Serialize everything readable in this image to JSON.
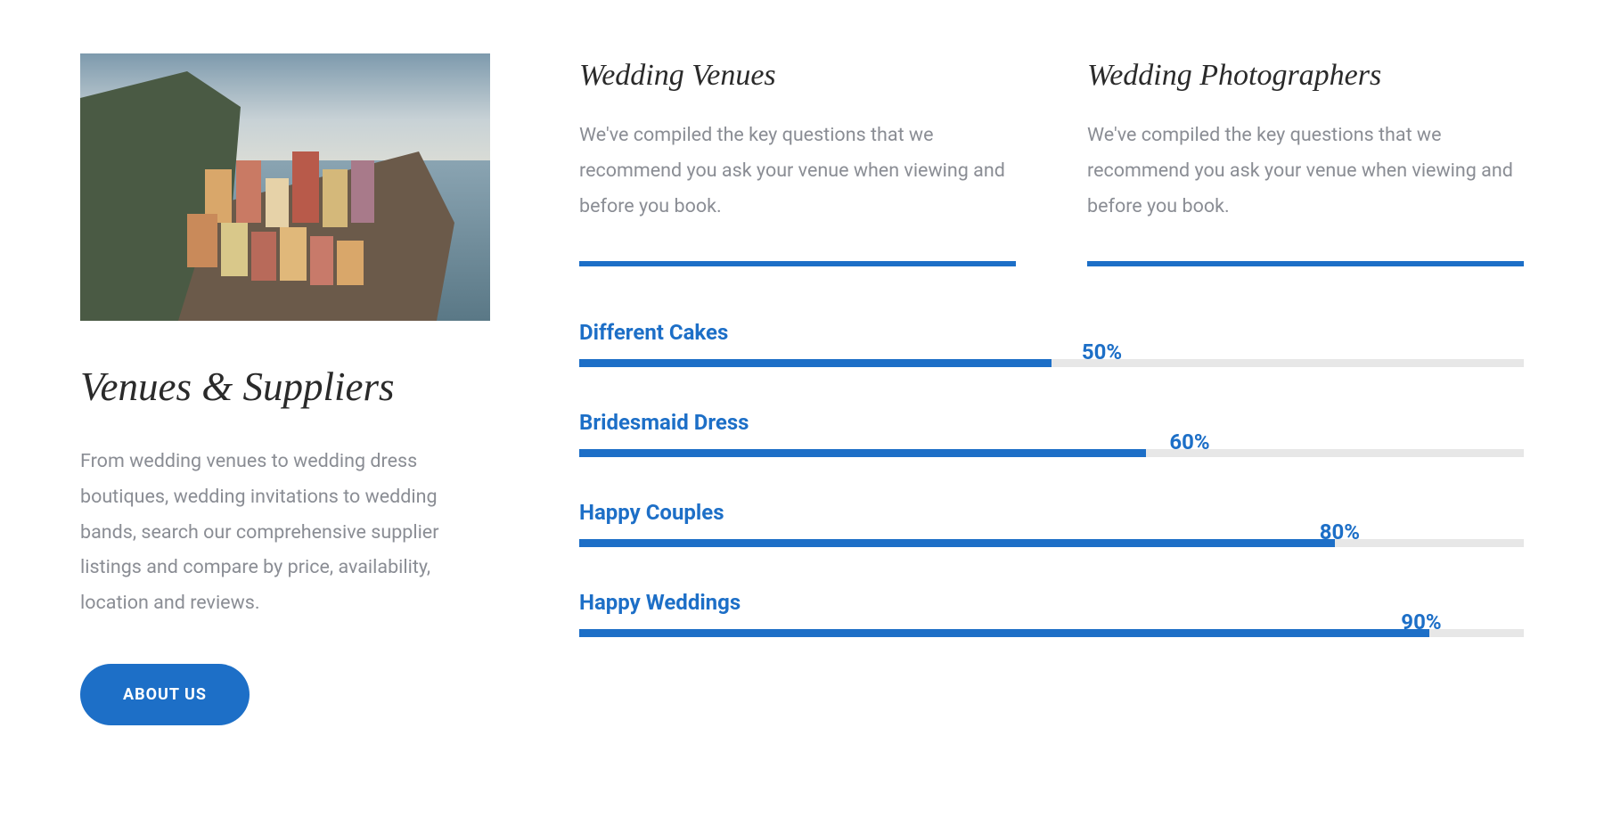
{
  "left": {
    "title": "Venues & Suppliers",
    "description": "From wedding venues to wedding dress boutiques, wedding invitations to wedding bands, search our comprehensive supplier listings and compare by price, availability, location and reviews.",
    "button_label": "ABOUT US"
  },
  "top_blocks": [
    {
      "title": "Wedding Venues",
      "description": "We've compiled the key questions that we recommend you ask your venue when viewing and before you book."
    },
    {
      "title": "Wedding Photographers",
      "description": "We've compiled the key questions that we recommend you ask your venue when viewing and before you book."
    }
  ],
  "chart_data": {
    "type": "bar",
    "orientation": "horizontal",
    "series": [
      {
        "name": "Different Cakes",
        "value": 50,
        "display": "50%"
      },
      {
        "name": "Bridesmaid Dress",
        "value": 60,
        "display": "60%"
      },
      {
        "name": "Happy Couples",
        "value": 80,
        "display": "80%"
      },
      {
        "name": "Happy Weddings",
        "value": 90,
        "display": "90%"
      }
    ],
    "xlim": [
      0,
      100
    ],
    "unit": "%",
    "colors": {
      "fill": "#1d6fc7",
      "track": "#e7e7e7",
      "label": "#1d6fc7"
    }
  }
}
